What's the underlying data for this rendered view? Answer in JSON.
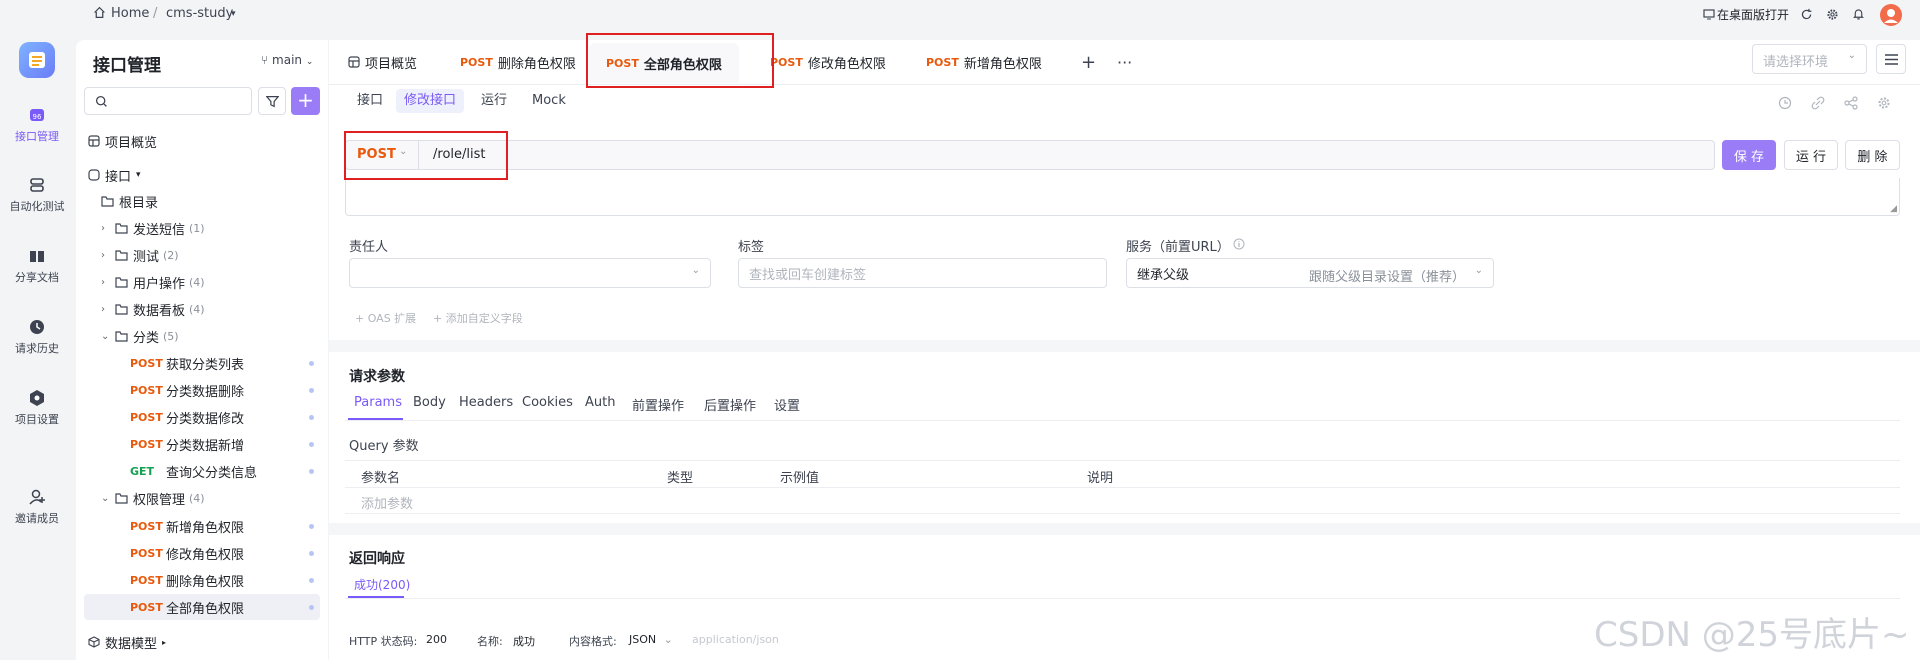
{
  "breadcrumb": {
    "home": "Home",
    "separator": "/",
    "project": "cms-study"
  },
  "topbar_right": {
    "open_desktop": "在桌面版打开"
  },
  "nav": [
    {
      "label": "接口管理",
      "icon": "api-icon",
      "active": true
    },
    {
      "label": "自动化测试",
      "icon": "automation-icon"
    },
    {
      "label": "分享文档",
      "icon": "book-icon"
    },
    {
      "label": "请求历史",
      "icon": "clock-icon"
    },
    {
      "label": "项目设置",
      "icon": "settings-icon"
    },
    {
      "label": "邀请成员",
      "icon": "add-user-icon"
    }
  ],
  "sidebar": {
    "title": "接口管理",
    "branch": "main",
    "overview": "项目概览",
    "api_root": "接口",
    "root_dir": "根目录",
    "folders": [
      {
        "name": "发送短信",
        "count": "(1)"
      },
      {
        "name": "测试",
        "count": "(2)"
      },
      {
        "name": "用户操作",
        "count": "(4)"
      },
      {
        "name": "数据看板",
        "count": "(4)"
      },
      {
        "name": "分类",
        "count": "(5)"
      }
    ],
    "category_apis": [
      {
        "method": "POST",
        "name": "获取分类列表"
      },
      {
        "method": "POST",
        "name": "分类数据删除"
      },
      {
        "method": "POST",
        "name": "分类数据修改"
      },
      {
        "method": "POST",
        "name": "分类数据新增"
      },
      {
        "method": "GET",
        "name": "查询父分类信息"
      }
    ],
    "perm_folder": {
      "name": "权限管理",
      "count": "(4)"
    },
    "perm_apis": [
      {
        "method": "POST",
        "name": "新增角色权限"
      },
      {
        "method": "POST",
        "name": "修改角色权限"
      },
      {
        "method": "POST",
        "name": "删除角色权限"
      },
      {
        "method": "POST",
        "name": "全部角色权限"
      }
    ],
    "data_model": "数据模型"
  },
  "tabs": {
    "overview": "项目概览",
    "items": [
      {
        "method": "POST",
        "name": "删除角色权限"
      },
      {
        "method": "POST",
        "name": "全部角色权限"
      },
      {
        "method": "POST",
        "name": "修改角色权限"
      },
      {
        "method": "POST",
        "name": "新增角色权限"
      }
    ],
    "env_placeholder": "请选择环境"
  },
  "subtabs": [
    "接口",
    "修改接口",
    "运行",
    "Mock"
  ],
  "request": {
    "method": "POST",
    "url": "/role/list",
    "save": "保 存",
    "run": "运 行",
    "delete": "删 除"
  },
  "fields": {
    "owner_label": "责任人",
    "tags_label": "标签",
    "tags_placeholder": "查找或回车创建标签",
    "service_label": "服务（前置URL）",
    "service_value": "继承父级",
    "service_hint": "跟随父级目录设置（推荐）",
    "oas_ext": "+ OAS 扩展",
    "custom_field": "+ 添加自定义字段"
  },
  "params": {
    "title": "请求参数",
    "tabs": [
      "Params",
      "Body",
      "Headers",
      "Cookies",
      "Auth",
      "前置操作",
      "后置操作",
      "设置"
    ],
    "query_title": "Query 参数",
    "columns": [
      "参数名",
      "类型",
      "示例值",
      "说明"
    ],
    "add_placeholder": "添加参数"
  },
  "response": {
    "title": "返回响应",
    "success_tab": "成功(200)",
    "status_label": "HTTP 状态码:",
    "status_value": "200",
    "name_label": "名称:",
    "name_value": "成功",
    "content_label": "内容格式:",
    "content_value": "JSON",
    "content_type": "application/json"
  },
  "watermark": "CSDN @25号底片~"
}
